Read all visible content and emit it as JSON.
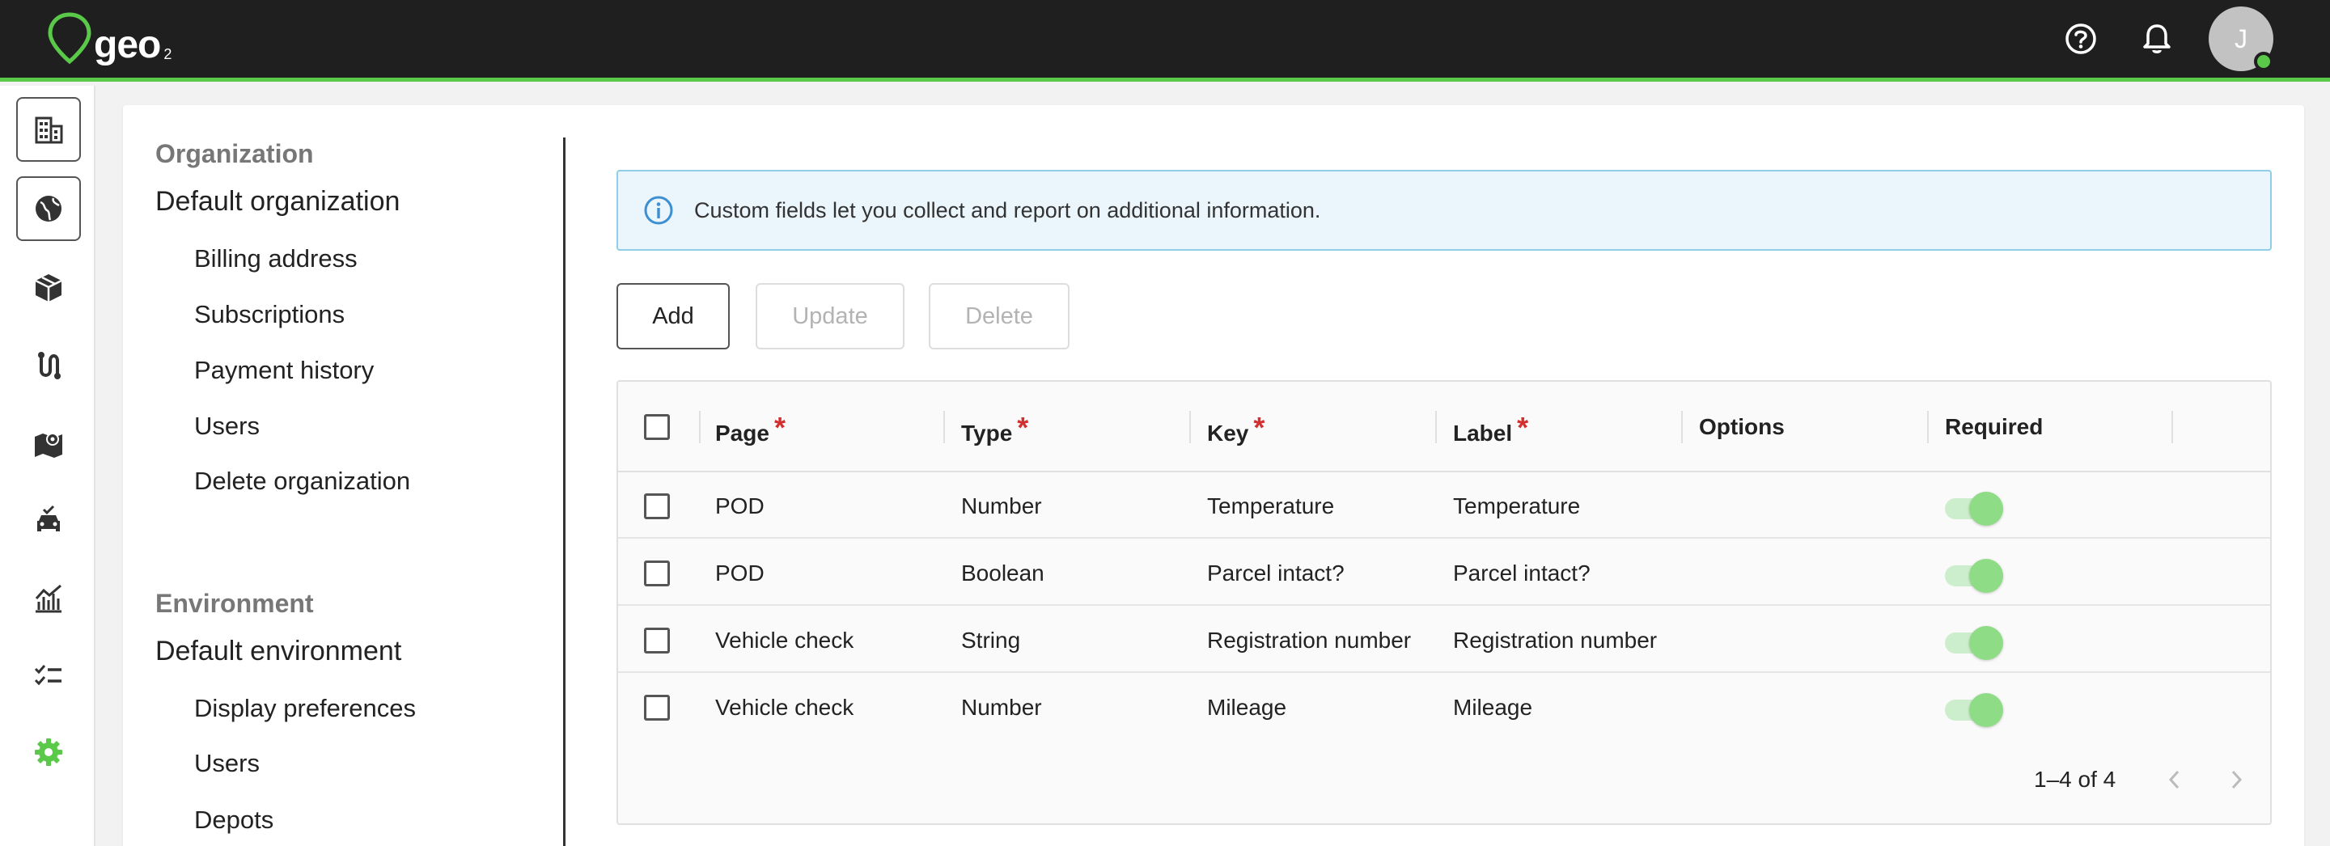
{
  "app": {
    "logo_text": "geo",
    "logo_sub": "2"
  },
  "header": {
    "help_icon": "help-circle-icon",
    "notifications_icon": "bell-icon",
    "user_initial": "J",
    "status_color": "#5ac94a"
  },
  "rail": {
    "items": [
      {
        "icon": "building-icon",
        "active": true
      },
      {
        "icon": "globe-icon",
        "active": true
      },
      {
        "icon": "package-icon",
        "active": false
      },
      {
        "icon": "route-icon",
        "active": false
      },
      {
        "icon": "map-icon",
        "active": false
      },
      {
        "icon": "vehicle-check-icon",
        "active": false
      },
      {
        "icon": "analytics-icon",
        "active": false
      },
      {
        "icon": "checklist-icon",
        "active": false
      },
      {
        "icon": "settings-icon",
        "active": true
      }
    ]
  },
  "settings_nav": {
    "organization_heading": "Organization",
    "organization_name": "Default organization",
    "organization_items": [
      "Billing address",
      "Subscriptions",
      "Payment history",
      "Users",
      "Delete organization"
    ],
    "environment_heading": "Environment",
    "environment_name": "Default environment",
    "environment_items": [
      "Display preferences",
      "Users",
      "Depots"
    ]
  },
  "info_banner": {
    "text": "Custom fields let you collect and report on additional information.",
    "icon": "info-icon"
  },
  "toolbar": {
    "add_label": "Add",
    "update_label": "Update",
    "delete_label": "Delete"
  },
  "table": {
    "columns": {
      "page": "Page",
      "type": "Type",
      "key": "Key",
      "label": "Label",
      "options": "Options",
      "required": "Required"
    },
    "required_marker": "*",
    "rows": [
      {
        "page": "POD",
        "type": "Number",
        "key": "Temperature",
        "label": "Temperature",
        "options": "",
        "required": true
      },
      {
        "page": "POD",
        "type": "Boolean",
        "key": "Parcel intact?",
        "label": "Parcel intact?",
        "options": "",
        "required": true
      },
      {
        "page": "Vehicle check",
        "type": "String",
        "key": "Registration number",
        "label": "Registration number",
        "options": "",
        "required": true
      },
      {
        "page": "Vehicle check",
        "type": "Number",
        "key": "Mileage",
        "label": "Mileage",
        "options": "",
        "required": true
      }
    ],
    "pagination": "1–4 of 4"
  },
  "colors": {
    "brand_green": "#5ac94a",
    "required_star": "#d32f2f",
    "info_border": "#8fcde9"
  }
}
